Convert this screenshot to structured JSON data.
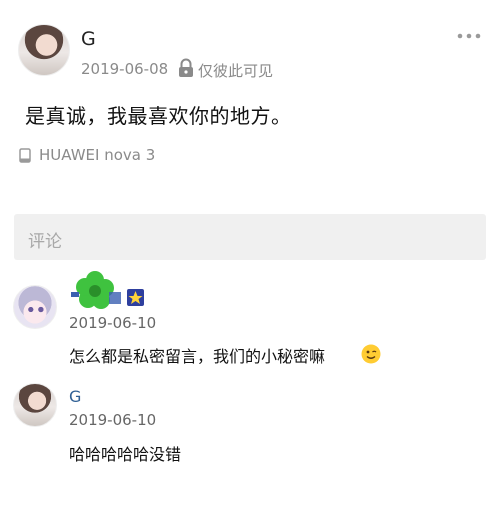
{
  "post": {
    "author": "G",
    "date": "2019-06-08",
    "visibility": "仅彼此可见",
    "content": "是真诚，我最喜欢你的地方。",
    "device": "HUAWEI nova 3"
  },
  "comment_input": {
    "placeholder": "评论"
  },
  "comments": [
    {
      "author_icon": "green-clover-name-logo",
      "date": "2019-06-10",
      "text": "怎么都是私密留言，我们的小秘密嘛",
      "emoji": "wink-emoji"
    },
    {
      "author": "G",
      "date": "2019-06-10",
      "text": "哈哈哈哈哈没错"
    }
  ],
  "colors": {
    "meta_gray": "#8a8a8a",
    "link_blue": "#2f5f94",
    "input_bg": "#f0f0f0"
  }
}
